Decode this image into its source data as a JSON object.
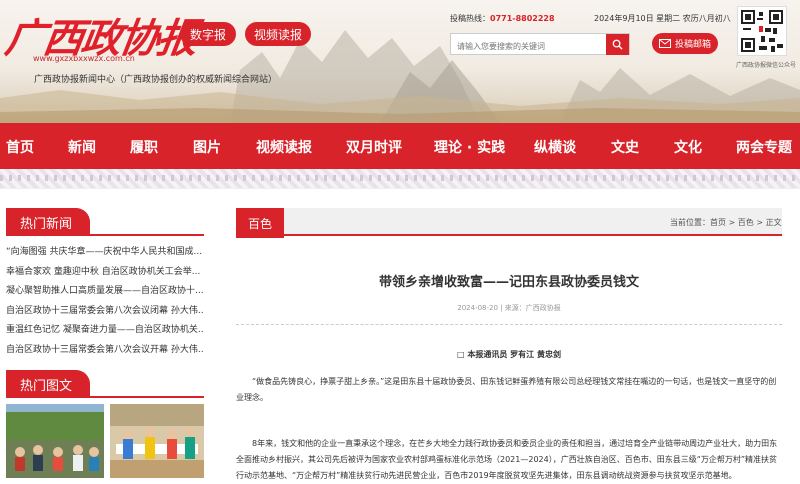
{
  "header": {
    "logo": "广西政协报",
    "logo_url": "www.gxzxbxxwzx.com.cn",
    "btn_digital": "数字报",
    "btn_video": "视频读报",
    "subtitle": "广西政协报新闻中心（广西政协报创办的权威新闻综合网站）",
    "hotline_label": "投稿热线：",
    "hotline_number": "0771-8802228",
    "date": "2024年9月10日  星期二  农历八月初八",
    "search_placeholder": "请输入您要搜索的关键词",
    "mail_label": "投稿邮箱",
    "qr_caption": "广西政协报微信公众号"
  },
  "nav": [
    "首页",
    "新闻",
    "履职",
    "图片",
    "视频读报",
    "双月时评",
    "理论 · 实践",
    "纵横谈",
    "文史",
    "文化",
    "两会专题"
  ],
  "sidebar": {
    "hot_news_title": "热门新闻",
    "hot_news": [
      "“向海图强 共庆华章——庆祝中华人民共和国成...",
      "幸福合家欢 童趣迎中秋 自治区政协机关工会举...",
      "凝心聚智助推人口高质量发展——自治区政协十...",
      "自治区政协十三届常委会第八次会议闭幕 孙大伟...",
      "重温红色记忆 凝聚奋进力量——自治区政协机关...",
      "自治区政协十三届常委会第八次会议开幕 孙大伟..."
    ],
    "hot_images_title": "热门图文"
  },
  "article": {
    "section": "百色",
    "breadcrumb": "当前位置：首页 > 百色 > 正文",
    "title": "带领乡亲增收致富——记田东县政协委员钱文",
    "meta": "2024-08-20 | 来源：广西政协报",
    "byline": "□ 本报通讯员  罗有江  黄忠剑",
    "para1": "“做食品先铸良心，挣票子甜上乡亲。”这是田东县十届政协委员、田东钱记鲜蛋养殖有限公司总经理钱文常挂在嘴边的一句话，也是钱文一直坚守的创业理念。",
    "para2": "8年来，钱文和他的企业一直秉承这个理念，在芒乡大地全力践行政协委员和委员企业的责任和担当，通过培育全产业链带动周边产业壮大，助力田东全面推动乡村振兴，其公司先后被评为国家农业农村部鸡蛋标准化示范场（2021—2024），广西壮族自治区、百色市、田东县三级“万企帮万村”精准扶贫行动示范基地、“万企帮万村”精准扶贫行动先进民营企业，百色市2019年度脱贫攻坚先进集体，田东县调动统战资源参与扶贫攻坚示范基地。"
  },
  "colors": {
    "brand_red": "#d8232a",
    "nav_text": "#ffffff"
  }
}
